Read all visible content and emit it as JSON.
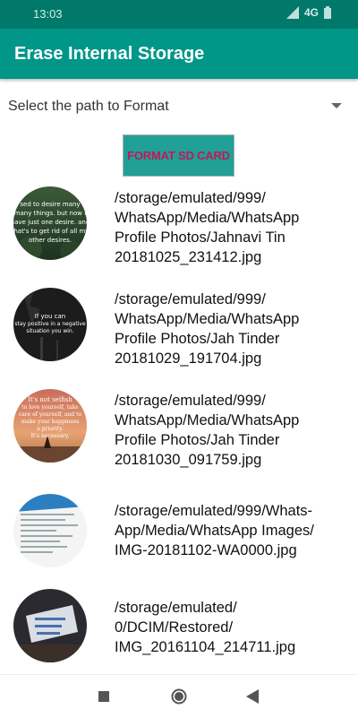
{
  "status": {
    "time": "13:03",
    "network": "4G"
  },
  "app": {
    "title": "Erase Internal Storage"
  },
  "spinner": {
    "label": "Select the path to Format"
  },
  "button": {
    "format_label": "FORMAT SD CARD"
  },
  "files": [
    {
      "path": "/storage/emulated/999/\nWhatsApp/Media/WhatsApp\nProfile Photos/Jahnavi Tin\n20181025_231412.jpg",
      "thumb_text": [
        "sed to desire many",
        "many things. but now I",
        "have just one desire. and",
        "that's to get rid of all my",
        "other desires."
      ]
    },
    {
      "path": "/storage/emulated/999/\nWhatsApp/Media/WhatsApp\nProfile Photos/Jah Tinder\n20181029_191704.jpg",
      "thumb_text": [
        "If you can",
        "stay positive in a negative",
        "situation you win."
      ]
    },
    {
      "path": "/storage/emulated/999/\nWhatsApp/Media/WhatsApp\nProfile Photos/Jah Tinder\n20181030_091759.jpg",
      "thumb_text": [
        "It's not selfish",
        "to love yourself, take",
        "care of yourself, and to",
        "make your happiness",
        "a priority.",
        "It's necessary."
      ]
    },
    {
      "path": "/storage/emulated/999/Whats-\nApp/Media/WhatsApp Images/\nIMG-20181102-WA0000.jpg",
      "thumb_text": []
    },
    {
      "path": "/storage/emulated/\n0/DCIM/Restored/\nIMG_20161104_214711.jpg",
      "thumb_text": []
    }
  ]
}
